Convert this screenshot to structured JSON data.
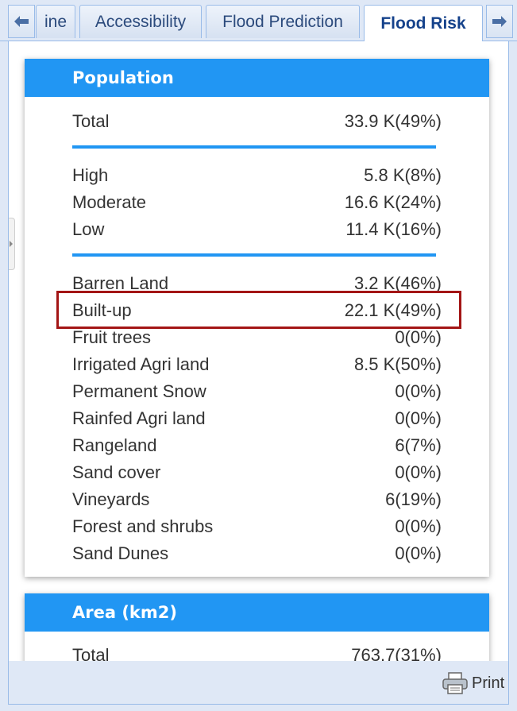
{
  "tabs": [
    {
      "label": "ine"
    },
    {
      "label": "Accessibility"
    },
    {
      "label": "Flood Prediction"
    },
    {
      "label": "Flood Risk"
    }
  ],
  "population": {
    "title": "Population",
    "total": {
      "label": "Total",
      "value": "33.9 K(49%)"
    },
    "risk": [
      {
        "label": "High",
        "value": "5.8 K(8%)"
      },
      {
        "label": "Moderate",
        "value": "16.6 K(24%)"
      },
      {
        "label": "Low",
        "value": "11.4 K(16%)"
      }
    ],
    "landcover": [
      {
        "label": "Barren Land",
        "value": "3.2 K(46%)"
      },
      {
        "label": "Built-up",
        "value": "22.1 K(49%)"
      },
      {
        "label": "Fruit trees",
        "value": "0(0%)"
      },
      {
        "label": "Irrigated Agri land",
        "value": "8.5 K(50%)"
      },
      {
        "label": "Permanent Snow",
        "value": "0(0%)"
      },
      {
        "label": "Rainfed Agri land",
        "value": "0(0%)"
      },
      {
        "label": "Rangeland",
        "value": "6(7%)"
      },
      {
        "label": "Sand cover",
        "value": "0(0%)"
      },
      {
        "label": "Vineyards",
        "value": "6(19%)"
      },
      {
        "label": "Forest and shrubs",
        "value": "0(0%)"
      },
      {
        "label": "Sand Dunes",
        "value": "0(0%)"
      }
    ]
  },
  "area": {
    "title": "Area (km2)",
    "total": {
      "label": "Total",
      "value": "763.7(31%)"
    }
  },
  "footer": {
    "print_label": "Print"
  },
  "colors": {
    "accent": "#2196f3",
    "highlight": "#a31515",
    "tab_text": "#15428b"
  }
}
